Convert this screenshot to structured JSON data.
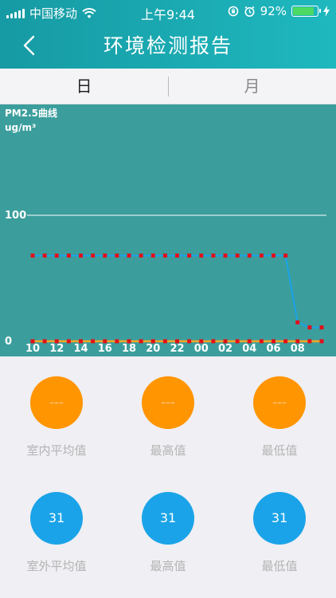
{
  "status_bar": {
    "carrier": "中国移动",
    "time": "上午9:44",
    "battery": "92%",
    "battery_level": 0.92
  },
  "header": {
    "title": "环境检测报告"
  },
  "tabs": [
    {
      "label": "日",
      "active": true
    },
    {
      "label": "月",
      "active": false
    }
  ],
  "chart_data": {
    "type": "line",
    "title": "PM2.5曲线",
    "ylabel": "ug/m³",
    "ylim": [
      0,
      100
    ],
    "y_ticks": [
      0,
      100
    ],
    "x_ticks": [
      "10",
      "12",
      "14",
      "16",
      "18",
      "20",
      "22",
      "00",
      "02",
      "04",
      "06",
      "08"
    ],
    "grid": false,
    "series": [
      {
        "color": "#e0101a",
        "style": "dotted",
        "x": [
          0,
          1,
          2,
          3,
          4,
          5,
          6,
          7,
          8,
          9,
          10,
          11,
          12,
          13,
          14,
          15,
          16,
          17,
          18,
          19,
          20,
          21,
          22,
          23,
          24
        ],
        "values": [
          68,
          68,
          68,
          68,
          68,
          68,
          68,
          68,
          68,
          68,
          68,
          68,
          68,
          68,
          68,
          68,
          68,
          68,
          68,
          68,
          68,
          68,
          15,
          11,
          11
        ]
      },
      {
        "color": "#1aa3e8",
        "style": "solid",
        "x": [
          0,
          21,
          22,
          23,
          24
        ],
        "values": [
          68,
          68,
          15,
          11,
          11
        ]
      },
      {
        "color": "#e0101a",
        "style": "dotted",
        "x": [
          0,
          1,
          2,
          3,
          4,
          5,
          6,
          7,
          8,
          9,
          10,
          11,
          12,
          13,
          14,
          15,
          16,
          17,
          18,
          19,
          20,
          21,
          22,
          23,
          24
        ],
        "values": [
          0,
          0,
          0,
          0,
          0,
          0,
          0,
          0,
          0,
          0,
          0,
          0,
          0,
          0,
          0,
          0,
          0,
          0,
          0,
          0,
          0,
          0,
          0,
          0,
          0
        ]
      },
      {
        "color": "#f5a623",
        "style": "solid",
        "x": [
          0,
          24
        ],
        "values": [
          0,
          0
        ]
      }
    ]
  },
  "indoor": {
    "average": {
      "value": "---",
      "label": "室内平均值"
    },
    "max": {
      "value": "---",
      "label": "最高值"
    },
    "min": {
      "value": "---",
      "label": "最低值"
    }
  },
  "outdoor": {
    "average": {
      "value": "31",
      "label": "室外平均值"
    },
    "max": {
      "value": "31",
      "label": "最高值"
    },
    "min": {
      "value": "31",
      "label": "最低值"
    }
  },
  "colors": {
    "header_start": "#169aa3",
    "header_end": "#1fb8bf",
    "chart_bg": "#3b9e9d",
    "indoor_circle": "#ff9500",
    "outdoor_circle": "#1aa3e8"
  }
}
